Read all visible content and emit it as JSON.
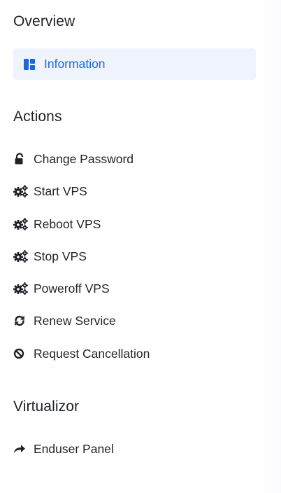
{
  "overview": {
    "title": "Overview",
    "items": [
      {
        "label": "Information",
        "icon": "dashboard-icon",
        "active": true
      }
    ]
  },
  "actions": {
    "title": "Actions",
    "items": [
      {
        "label": "Change Password",
        "icon": "lock-icon"
      },
      {
        "label": "Start VPS",
        "icon": "cogs-icon"
      },
      {
        "label": "Reboot VPS",
        "icon": "cogs-icon"
      },
      {
        "label": "Stop VPS",
        "icon": "cogs-icon"
      },
      {
        "label": "Poweroff VPS",
        "icon": "cogs-icon"
      },
      {
        "label": "Renew Service",
        "icon": "sync-icon"
      },
      {
        "label": "Request Cancellation",
        "icon": "ban-icon"
      }
    ]
  },
  "virtualizor": {
    "title": "Virtualizor",
    "items": [
      {
        "label": "Enduser Panel",
        "icon": "share-arrow-icon"
      }
    ]
  },
  "colors": {
    "accent": "#2167d7",
    "active_bg": "#eef3fc",
    "text": "#1f2329",
    "heading": "#1d2127"
  }
}
